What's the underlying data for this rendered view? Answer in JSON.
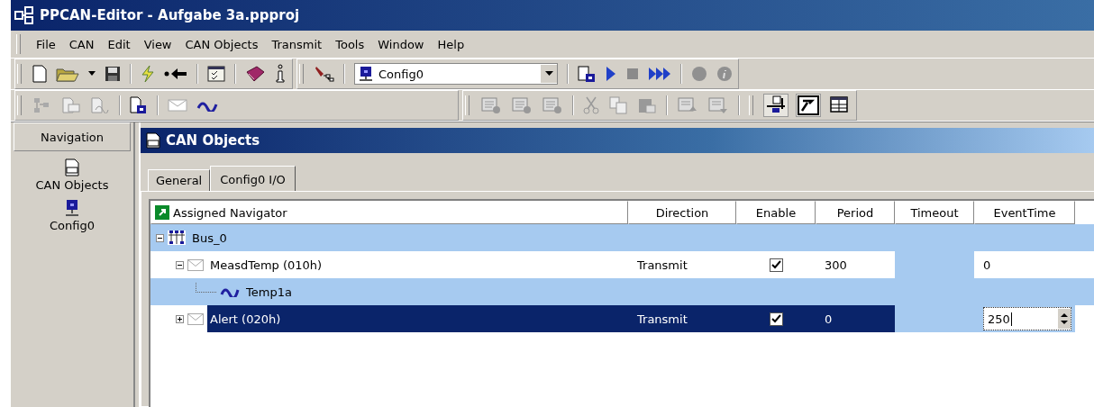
{
  "window": {
    "title": "PPCAN-Editor - Aufgabe 3a.ppproj"
  },
  "menu": [
    {
      "label": "File"
    },
    {
      "label": "CAN"
    },
    {
      "label": "Edit"
    },
    {
      "label": "View"
    },
    {
      "label": "CAN Objects"
    },
    {
      "label": "Transmit"
    },
    {
      "label": "Tools"
    },
    {
      "label": "Window"
    },
    {
      "label": "Help"
    }
  ],
  "config_combo": {
    "value": "Config0"
  },
  "navigation": {
    "title": "Navigation",
    "items": [
      {
        "label": "CAN Objects",
        "kind": "can"
      },
      {
        "label": "Config0",
        "kind": "config"
      }
    ]
  },
  "child_window": {
    "title": "CAN Objects"
  },
  "tabs": [
    {
      "label": "General",
      "selected": false
    },
    {
      "label": "Config0 I/O",
      "selected": true
    }
  ],
  "table": {
    "columns": [
      "Assigned Navigator",
      "Direction",
      "Enable",
      "Period",
      "Timeout",
      "EventTime"
    ],
    "rows": [
      {
        "kind": "bus",
        "label": "Bus_0",
        "expanded": true,
        "selected": false,
        "children": [
          {
            "kind": "message",
            "label": "MeasdTemp (010h)",
            "expanded": true,
            "selected": false,
            "direction": "Transmit",
            "enable": true,
            "period": "300",
            "event_time": "0",
            "children": [
              {
                "kind": "signal",
                "label": "Temp1a",
                "selected": false
              }
            ]
          },
          {
            "kind": "message",
            "label": "Alert (020h)",
            "expanded": false,
            "selected": true,
            "direction": "Transmit",
            "enable": true,
            "period": "0",
            "event_time": "250"
          }
        ]
      }
    ]
  }
}
